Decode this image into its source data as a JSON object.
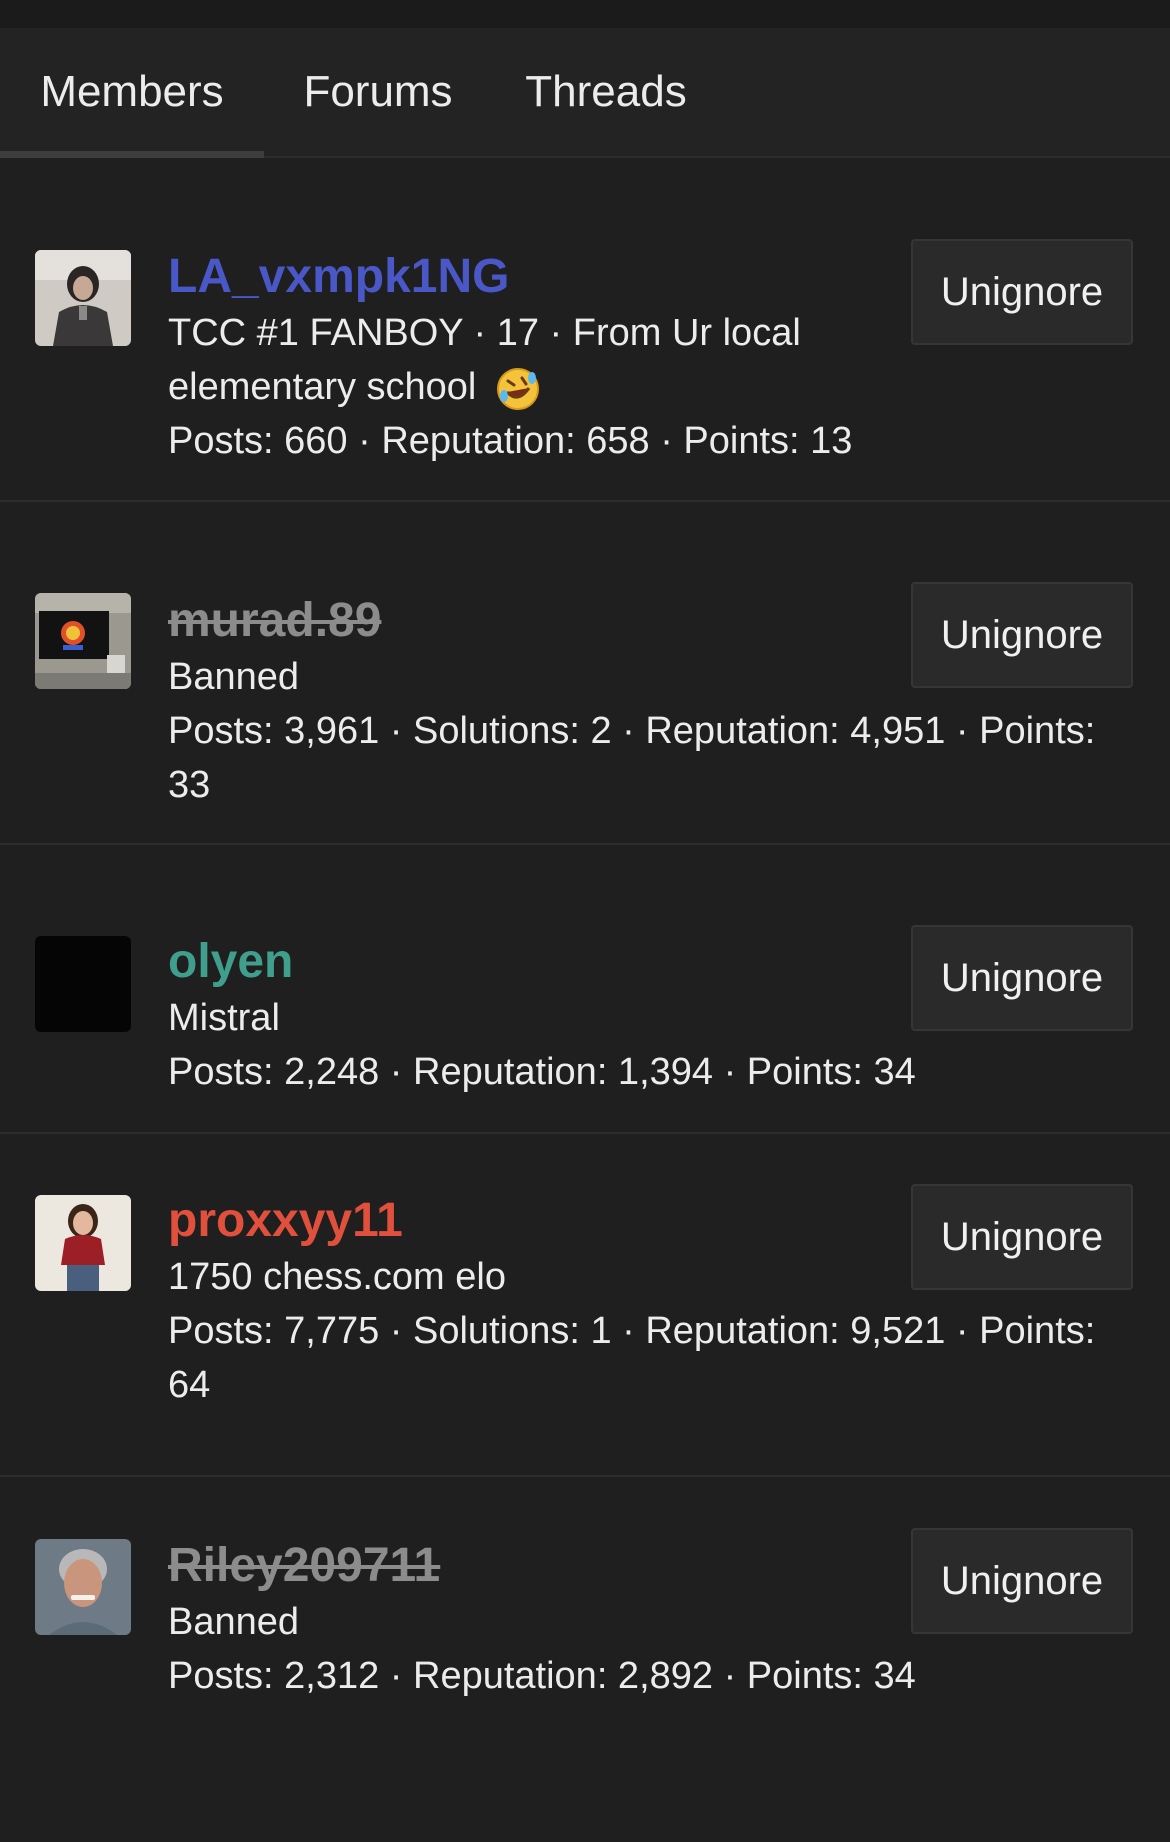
{
  "tabs": [
    {
      "label": "Members",
      "active": true
    },
    {
      "label": "Forums",
      "active": false
    },
    {
      "label": "Threads",
      "active": false
    }
  ],
  "members": [
    {
      "username": "LA_vxmpk1NG",
      "username_color": "#4a57c7",
      "banned": false,
      "title": "TCC #1 FANBOY · 17 · From Ur local elementary school",
      "title_emoji": "rolling-on-floor-laughing-emoji",
      "stats": "Posts: 660 · Reputation: 658 · Points: 13",
      "button": "Unignore",
      "avatar_icon": "user-photo-avatar"
    },
    {
      "username": "murad.89",
      "username_color": "#8c8c8c",
      "banned": true,
      "title": "Banned",
      "stats": "Posts: 3,961 · Solutions: 2 · Reputation: 4,951 · Points: 33",
      "button": "Unignore",
      "avatar_icon": "tv-photo-avatar"
    },
    {
      "username": "olyen",
      "username_color": "#3f9e8c",
      "banned": false,
      "title": "Mistral",
      "stats": "Posts: 2,248 · Reputation: 1,394 · Points: 34",
      "button": "Unignore",
      "avatar_icon": "black-avatar"
    },
    {
      "username": "proxxyy11",
      "username_color": "#e0503c",
      "banned": false,
      "title": "1750 chess.com elo",
      "stats": "Posts: 7,775 · Solutions: 1 · Reputation: 9,521 · Points: 64",
      "button": "Unignore",
      "avatar_icon": "user-photo-avatar"
    },
    {
      "username": "Riley209711",
      "username_color": "#8c8c8c",
      "banned": true,
      "title": "Banned",
      "stats": "Posts: 2,312 · Reputation: 2,892 · Points: 34",
      "button": "Unignore",
      "avatar_icon": "user-photo-avatar"
    }
  ]
}
